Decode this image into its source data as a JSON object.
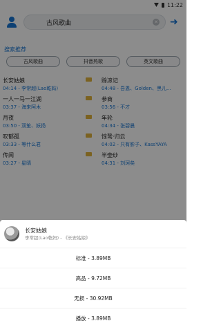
{
  "status_bar": {
    "time": "11:22"
  },
  "search": {
    "value": "古风歌曲"
  },
  "hint": "搜索推荐",
  "tags": [
    "古风歌曲",
    "抖音热歌",
    "英文歌曲"
  ],
  "songs": [
    {
      "name": "长安姑娘",
      "meta": "04:14 - 李常超(Lao乾妈)"
    },
    {
      "name": "赊凉记",
      "meta": "04:48 - 吾恩、Golden、黑儿..."
    },
    {
      "name": "一人一马一江湖",
      "meta": "03:37 - 海来阿木"
    },
    {
      "name": "参商",
      "meta": "03:56 - 不才"
    },
    {
      "name": "月夜",
      "meta": "03:50 - 双笙、妖扬"
    },
    {
      "name": "年轮",
      "meta": "04:34 - 张碧晨"
    },
    {
      "name": "叹郁孤",
      "meta": "03:33 - 等什么君"
    },
    {
      "name": "惊鸷·归云",
      "meta": "04:02 - 只有影子、KassYAYA"
    },
    {
      "name": "传闻",
      "meta": "03:27 - 星晴"
    },
    {
      "name": "半壶纱",
      "meta": "04:31 - 刘珂矣"
    },
    {
      "name": "",
      "meta": ""
    },
    {
      "name": "",
      "meta": ""
    }
  ],
  "sheet": {
    "title": "长安姑娘",
    "subtitle": "李常超(Lao乾妈) - 《长安姑娘》",
    "options": [
      "标准 - 3.89MB",
      "高品 - 9.72MB",
      "无损 - 30.92MB",
      "播放 - 3.89MB"
    ]
  }
}
